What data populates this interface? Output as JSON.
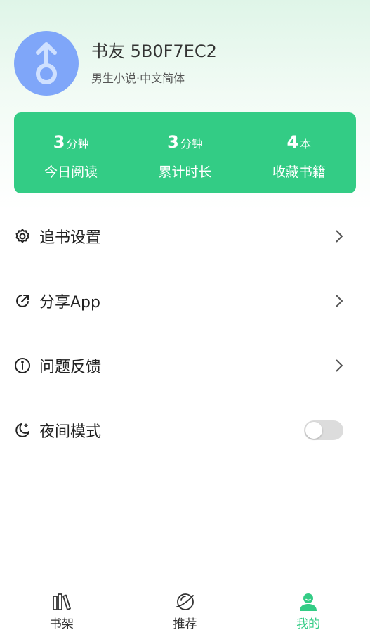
{
  "profile": {
    "username": "书友 5B0F7EC2",
    "tags": "男生小说·中文简体",
    "avatar_icon": "male-symbol-icon",
    "avatar_color": "#7fa6f9"
  },
  "stats": [
    {
      "value": "3",
      "unit": "分钟",
      "label": "今日阅读"
    },
    {
      "value": "3",
      "unit": "分钟",
      "label": "累计时长"
    },
    {
      "value": "4",
      "unit": "本",
      "label": "收藏书籍"
    }
  ],
  "menu": {
    "items": [
      {
        "label": "追书设置",
        "icon": "gear-icon"
      },
      {
        "label": "分享App",
        "icon": "share-icon"
      },
      {
        "label": "问题反馈",
        "icon": "info-icon"
      },
      {
        "label": "夜间模式",
        "icon": "moon-icon",
        "toggle_on": false
      }
    ]
  },
  "tabbar": {
    "tabs": [
      {
        "label": "书架",
        "icon": "bookshelf-icon",
        "active": false
      },
      {
        "label": "推荐",
        "icon": "planet-icon",
        "active": false
      },
      {
        "label": "我的",
        "icon": "user-icon",
        "active": true
      }
    ]
  },
  "colors": {
    "accent": "#33cc85",
    "avatar": "#7fa6f9"
  }
}
